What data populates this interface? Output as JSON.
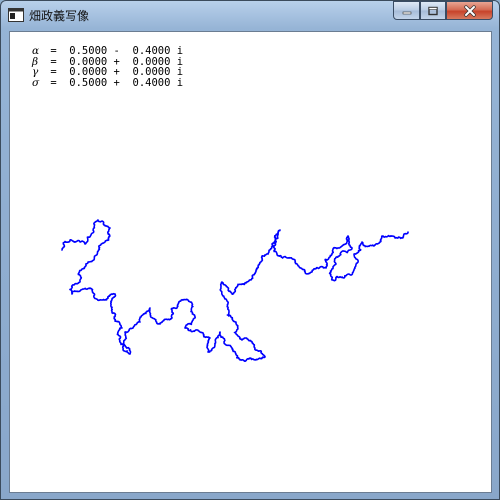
{
  "window": {
    "title": "畑政義写像",
    "icon": "app-window-icon",
    "controls": [
      "minimize-icon",
      "maximize-icon",
      "close-icon"
    ]
  },
  "parameters": [
    {
      "symbol": "α",
      "text": " =  0.5000 -  0.4000 i"
    },
    {
      "symbol": "β",
      "text": " =  0.0000 +  0.0000 i"
    },
    {
      "symbol": "γ",
      "text": " =  0.0000 +  0.0000 i"
    },
    {
      "symbol": "σ",
      "text": " =  0.5000 +  0.4000 i"
    }
  ],
  "plot": {
    "color": "#0000ff",
    "background": "#ffffff"
  }
}
